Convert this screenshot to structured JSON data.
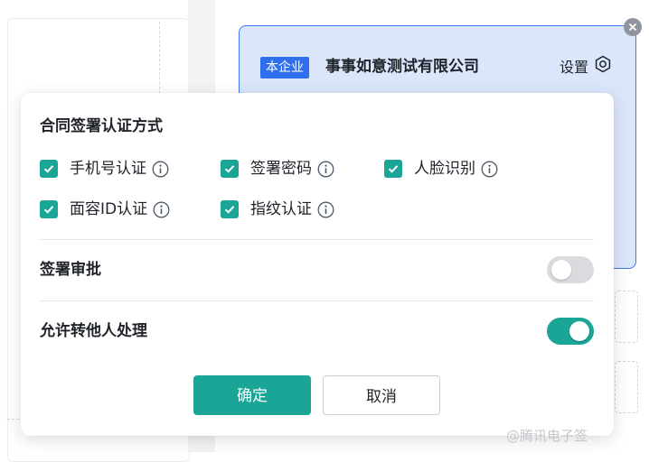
{
  "company_card": {
    "badge": "本企业",
    "name": "事事如意测试有限公司",
    "settings_label": "设置"
  },
  "popover": {
    "section_title": "合同签署认证方式",
    "auth_methods": [
      {
        "label": "手机号认证",
        "checked": true
      },
      {
        "label": "签署密码",
        "checked": true
      },
      {
        "label": "人脸识别",
        "checked": true
      },
      {
        "label": "面容ID认证",
        "checked": true
      },
      {
        "label": "指纹认证",
        "checked": true
      }
    ],
    "signing_approval": {
      "label": "签署审批",
      "enabled": false
    },
    "allow_transfer": {
      "label": "允许转他人处理",
      "enabled": true
    },
    "confirm_label": "确定",
    "cancel_label": "取消"
  },
  "watermark": {
    "text": "@腾讯电子签"
  },
  "colors": {
    "accent": "#1aa596",
    "card_border": "#3d7bf0",
    "card_bg": "#dbe6fb",
    "badge_bg": "#2f6fee"
  }
}
